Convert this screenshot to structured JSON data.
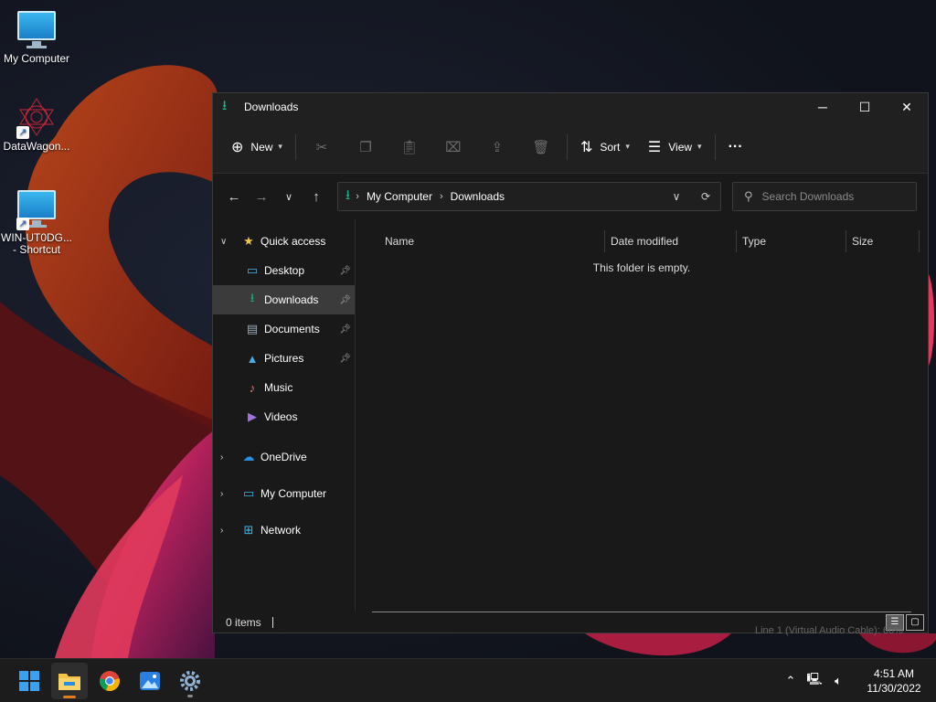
{
  "desktop": {
    "icons": [
      {
        "label": "My Computer"
      },
      {
        "label": "DataWagon..."
      },
      {
        "label_line1": "WIN-UT0DG...",
        "label_line2": "- Shortcut"
      }
    ]
  },
  "window": {
    "title": "Downloads",
    "controls": {
      "minimize": "─",
      "maximize": "☐",
      "close": "✕"
    }
  },
  "commandbar": {
    "new_label": "New",
    "sort_label": "Sort",
    "view_label": "View",
    "more_label": "···"
  },
  "address": {
    "crumbs": [
      "My Computer",
      "Downloads"
    ],
    "search_placeholder": "Search Downloads"
  },
  "sidebar": {
    "quick_access": "Quick access",
    "items": [
      {
        "label": "Desktop",
        "pinned": true
      },
      {
        "label": "Downloads",
        "pinned": true,
        "active": true
      },
      {
        "label": "Documents",
        "pinned": true
      },
      {
        "label": "Pictures",
        "pinned": true
      },
      {
        "label": "Music",
        "pinned": false
      },
      {
        "label": "Videos",
        "pinned": false
      }
    ],
    "roots": [
      "OneDrive",
      "My Computer",
      "Network"
    ]
  },
  "columns": [
    "Name",
    "Date modified",
    "Type",
    "Size"
  ],
  "content": {
    "empty_message": "This folder is empty."
  },
  "status": {
    "items_count": "0 items"
  },
  "background_text": "Line 1 (Virtual Audio Cable): 66%",
  "taskbar": {
    "time": "4:51 AM",
    "date": "11/30/2022"
  },
  "colors": {
    "accent_green": "#18b38a",
    "window_bg": "#191919",
    "taskbar_bg": "#1c1c1c"
  }
}
